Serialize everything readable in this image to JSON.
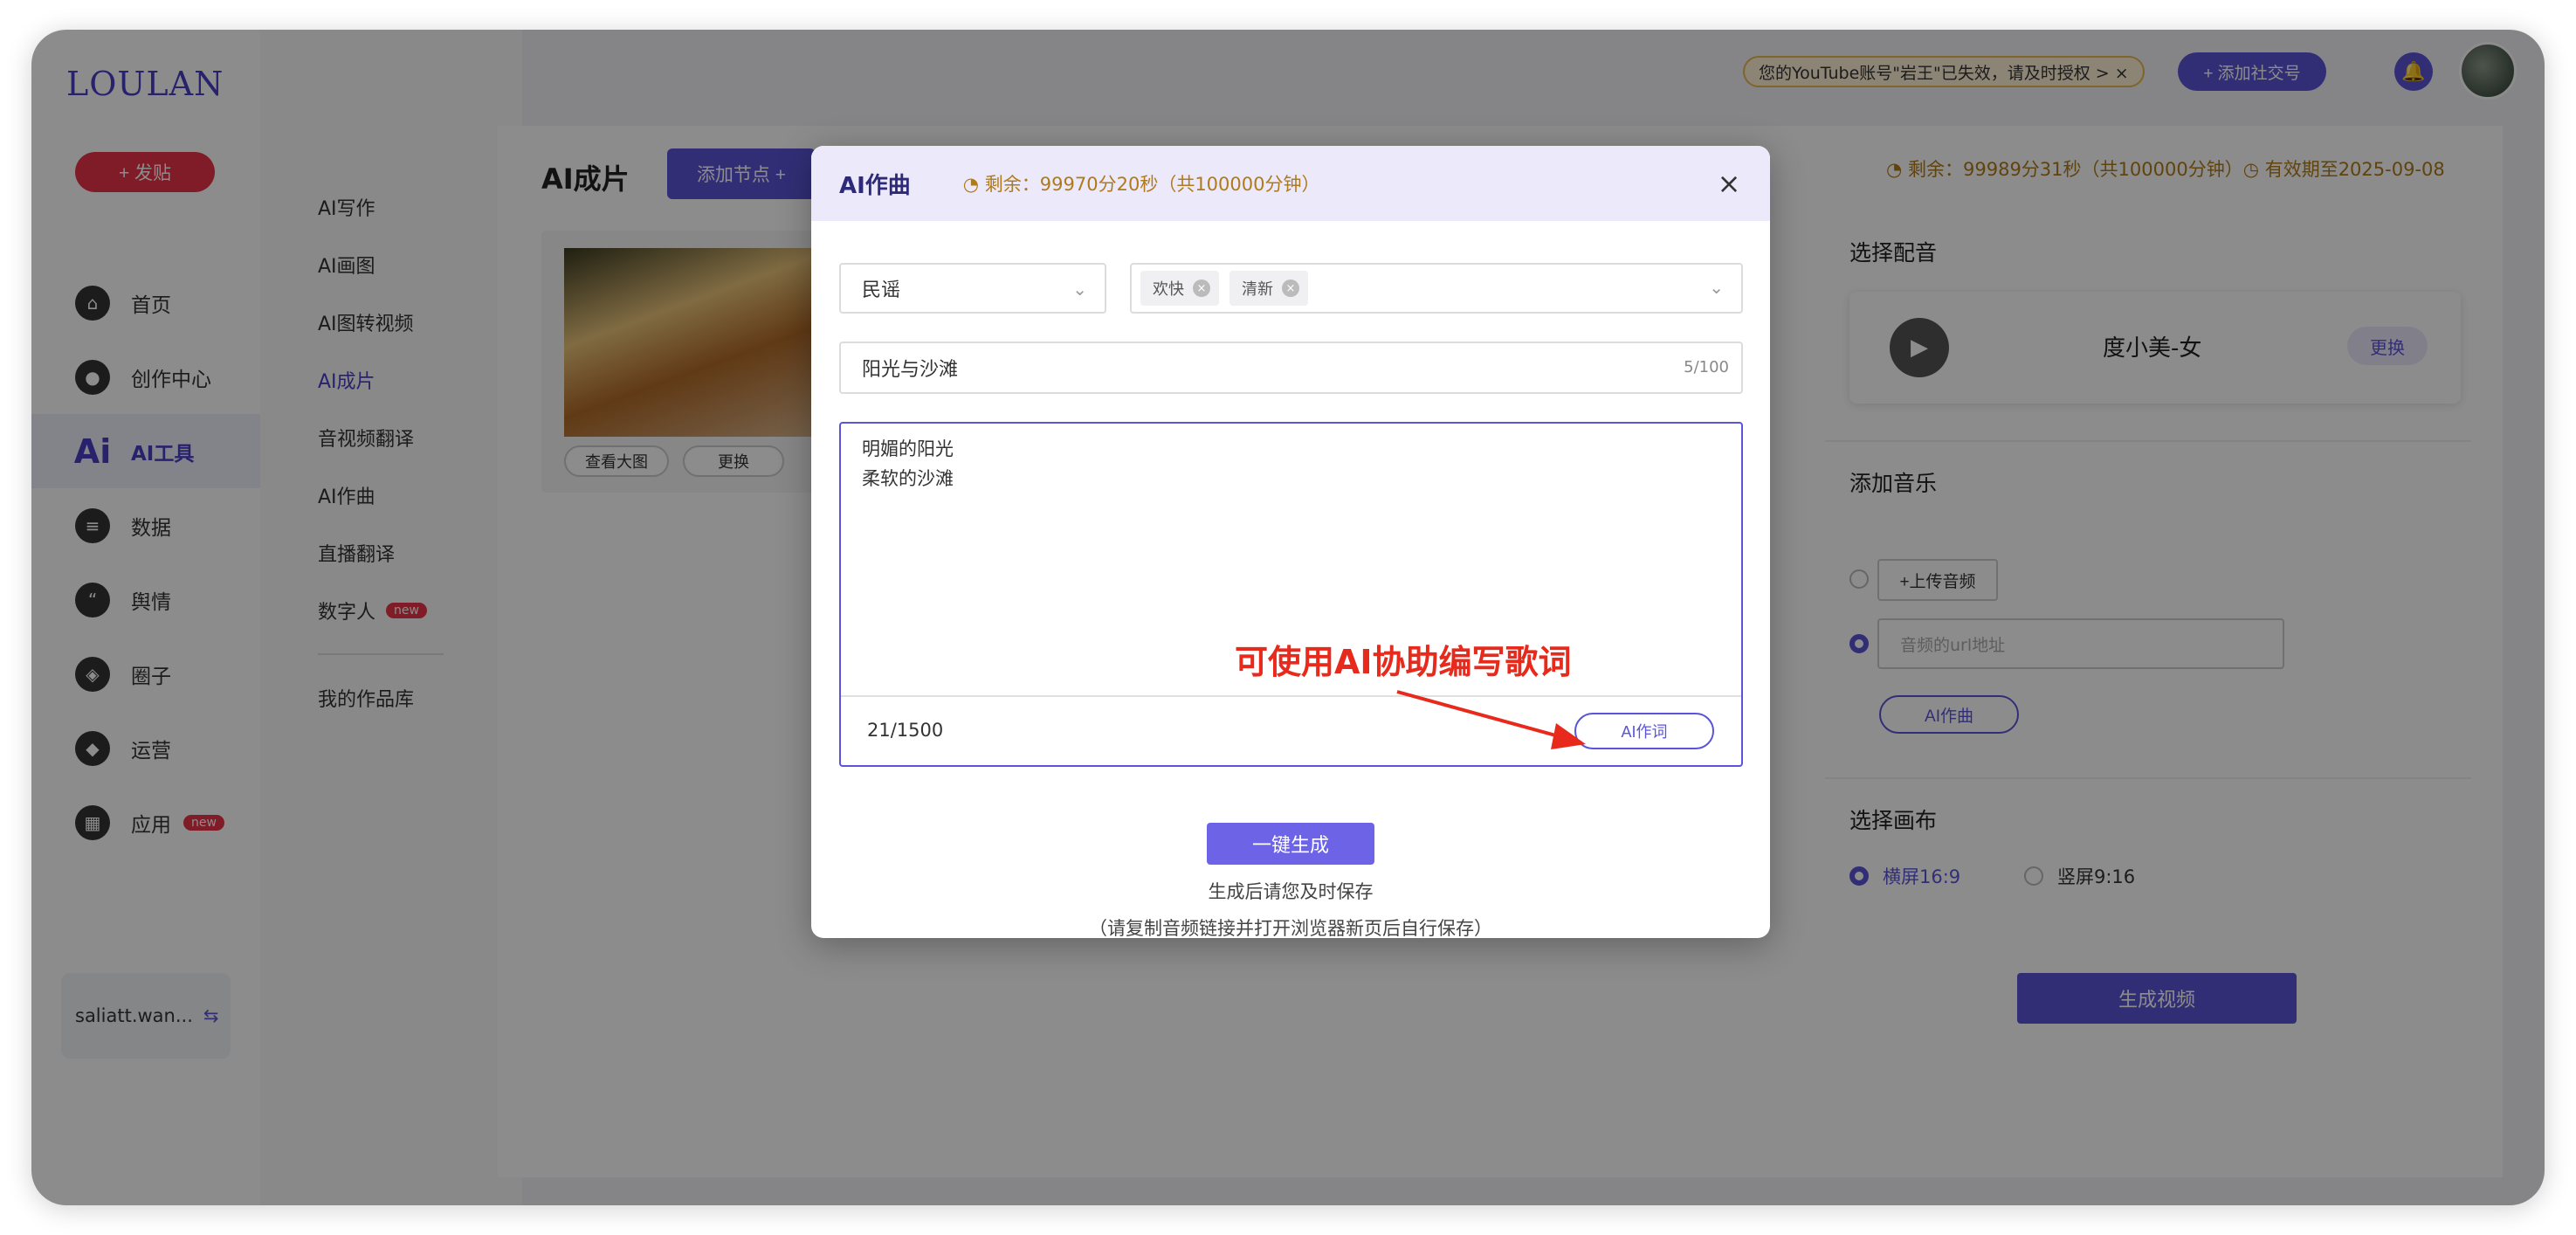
{
  "brand": {
    "logo": "LOULAN"
  },
  "sidebar": {
    "post_button": "+ 发贴",
    "items": [
      {
        "label": "首页",
        "icon": "home-icon"
      },
      {
        "label": "创作中心",
        "icon": "palette-icon"
      },
      {
        "label": "AI工具",
        "icon": "ai-icon",
        "active": true
      },
      {
        "label": "数据",
        "icon": "database-icon"
      },
      {
        "label": "舆情",
        "icon": "quote-icon"
      },
      {
        "label": "圈子",
        "icon": "compass-icon"
      },
      {
        "label": "运营",
        "icon": "shield-icon"
      },
      {
        "label": "应用",
        "icon": "apps-icon",
        "badge": "new"
      }
    ],
    "account": "saliatt.wan..."
  },
  "subnav": {
    "items": [
      "AI写作",
      "AI画图",
      "AI图转视频",
      "AI成片",
      "音视频翻译",
      "AI作曲",
      "直播翻译",
      "数字人"
    ],
    "digital_badge": "new",
    "library": "我的作品库"
  },
  "topbar": {
    "warning": "您的YouTube账号\"岩王\"已失效，请及时授权 > ×",
    "add_social": "+ 添加社交号"
  },
  "main": {
    "title": "AI成片",
    "add_node": "添加节点 +",
    "view_large": "查看大图",
    "replace": "更换",
    "remain": "◔ 剩余：99989分31秒（共100000分钟）◷ 有效期至2025-09-08"
  },
  "right_panel": {
    "voice_title": "选择配音",
    "voice_name": "度小美-女",
    "voice_change": "更换",
    "music_title": "添加音乐",
    "upload": "+上传音频",
    "url_placeholder": "音频的url地址",
    "ai_compose": "AI作曲",
    "canvas_title": "选择画布",
    "landscape": "横屏16:9",
    "portrait": "竖屏9:16",
    "generate_video": "生成视频"
  },
  "modal": {
    "title": "AI作曲",
    "remain": "◔ 剩余：99970分20秒（共100000分钟）",
    "genre": "民谣",
    "tags": [
      "欢快",
      "清新"
    ],
    "song_title": "阳光与沙滩",
    "title_count": "5/100",
    "lyrics": "明媚的阳光\n柔软的沙滩",
    "lyrics_count": "21/1500",
    "ai_lyrics_button": "AI作词",
    "generate_button": "一键生成",
    "note1": "生成后请您及时保存",
    "note2": "（请复制音频链接并打开浏览器新页后自行保存）"
  },
  "annotation": {
    "text": "可使用AI协助编写歌词",
    "color": "#e82a1c"
  },
  "colors": {
    "accent": "#5b54d8",
    "danger": "#e8334a"
  }
}
